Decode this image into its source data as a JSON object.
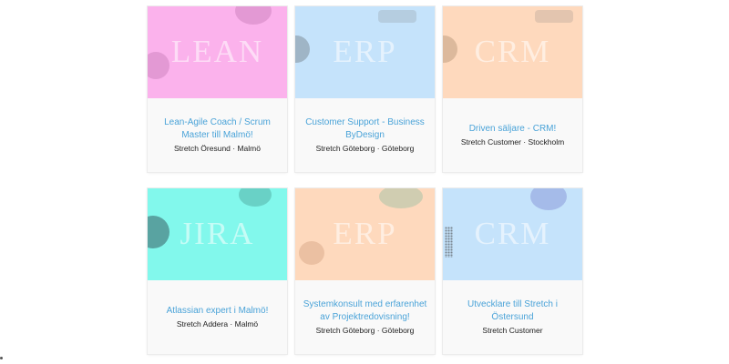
{
  "cards": [
    {
      "image_word": "LEAN",
      "bg_color": "#fbb2ec",
      "title": "Lean-Agile Coach / Scrum Master till Malmö!",
      "meta": "Stretch Öresund · Malmö"
    },
    {
      "image_word": "ERP",
      "bg_color": "#c5e3fb",
      "title": "Customer Support - Business ByDesign",
      "meta": "Stretch Göteborg · Göteborg"
    },
    {
      "image_word": "CRM",
      "bg_color": "#fed9bd",
      "title": "Driven säljare - CRM!",
      "meta": "Stretch Customer · Stockholm"
    },
    {
      "image_word": "JIRA",
      "bg_color": "#82f8ec",
      "title": "Atlassian expert i Malmö!",
      "meta": "Stretch Addera · Malmö"
    },
    {
      "image_word": "ERP",
      "bg_color": "#fed9bd",
      "title": "Systemkonsult med erfarenhet av Projektredovisning!",
      "meta": "Stretch Göteborg · Göteborg"
    },
    {
      "image_word": "CRM",
      "bg_color": "#c5e3fb",
      "title": "Utvecklare till Stretch i Östersund",
      "meta": "Stretch Customer"
    }
  ]
}
